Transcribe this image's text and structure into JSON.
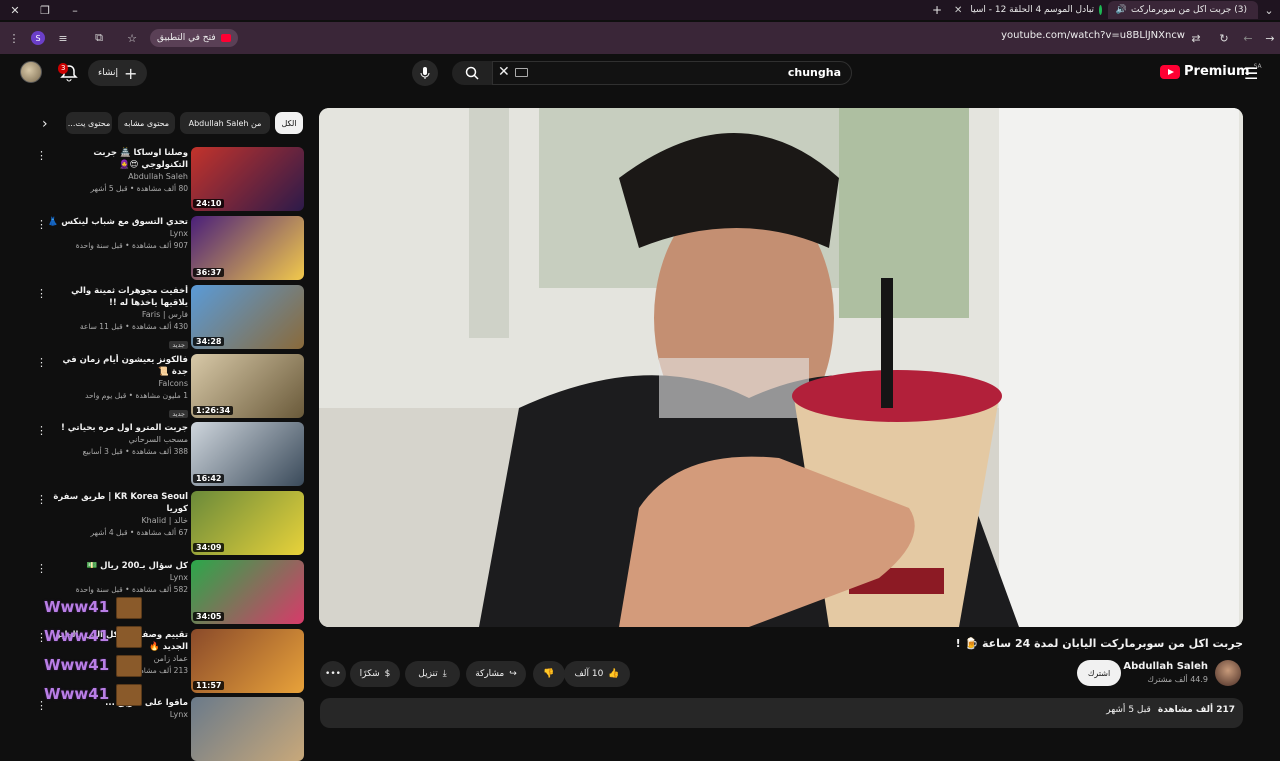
{
  "browser": {
    "tabs": [
      {
        "title": "(3) جربت اكل من سوبرماركت",
        "active": true,
        "fav_color": "#ff0033"
      },
      {
        "title": "تبادل الموسم 4 الحلقة 12 - اسيا",
        "active": false,
        "fav_color": "#1db954"
      }
    ],
    "url": "youtube.com/watch?v=u8BLlJNXncw",
    "open_in_app": "فتح في التطبيق",
    "extension_letter": "S"
  },
  "youtube": {
    "logo_text": "Premium",
    "logo_region": "SA",
    "search_value": "chungha",
    "create_label": "إنشاء",
    "notif_count": "3"
  },
  "video": {
    "title": "جربت اكل من سوبرماركت اليابان لمدة 24 ساعة 🍺 !",
    "channel": "Abdullah Saleh",
    "subscribers": "44.9 ألف مشترك",
    "subscribe_label": "اشترك",
    "likes": "10 آلف",
    "share_label": "مشاركة",
    "download_label": "تنزيل",
    "thanks_label": "شكرًا",
    "views_meta": "217 ألف مشاهدة",
    "date_meta": "قبل 5 أشهر"
  },
  "chips": [
    {
      "label": "الكل",
      "selected": true
    },
    {
      "label": "من Abdullah Saleh",
      "selected": false
    },
    {
      "label": "محتوى مشابه",
      "selected": false
    },
    {
      "label": "محتوى يت...",
      "selected": false
    }
  ],
  "related": [
    {
      "title": "وصلنا اوساكا 🏯 جربت التكنولوجي 😍🧕",
      "channel": "Abdullah Saleh",
      "meta": "80 ألف مشاهدة • قبل 5 أشهر",
      "duration": "24:10",
      "badge": "",
      "c1": "#c3332b",
      "c2": "#2c1a4a"
    },
    {
      "title": "تحدي التسوق مع شباب لينكس 👗",
      "channel": "Lynx",
      "meta": "907 ألف مشاهدة • قبل سنة واحدة",
      "duration": "36:37",
      "badge": "",
      "c1": "#4a1f7a",
      "c2": "#f2c94c"
    },
    {
      "title": "أخفيت مجوهرات ثمينة والي يلاقيها ياخذها له !!",
      "channel": "فارس | Faris",
      "meta": "430 ألف مشاهدة • قبل 11 ساعة",
      "duration": "34:28",
      "badge": "جديد",
      "c1": "#5a9bd8",
      "c2": "#8a6a3a"
    },
    {
      "title": "فالكونز يعيشون أيام زمان في جدة 📜",
      "channel": "Falcons",
      "meta": "1 مليون مشاهدة • قبل يوم واحد",
      "duration": "1:26:34",
      "badge": "جديد",
      "c1": "#d8c9a8",
      "c2": "#6a5a3a"
    },
    {
      "title": "جربت المترو اول مره بحياتي !",
      "channel": "مسحب السرحاني",
      "meta": "388 ألف مشاهدة • قبل 3 أسابيع",
      "duration": "16:42",
      "badge": "",
      "c1": "#cfd6dd",
      "c2": "#3a4a5a"
    },
    {
      "title": "KR Korea Seoul | طريق سفرة كوريا",
      "channel": "خالد | Khalid",
      "meta": "67 ألف مشاهدة • قبل 4 أشهر",
      "duration": "34:09",
      "badge": "",
      "c1": "#6a8a3a",
      "c2": "#e8d23a"
    },
    {
      "title": "كل سؤال بـ200 ريال 💵",
      "channel": "Lynx",
      "meta": "582 ألف مشاهدة • قبل سنة واحدة",
      "duration": "34:05",
      "badge": "",
      "c1": "#2aa84a",
      "c2": "#d83a6a"
    },
    {
      "title": "تقييم وصفات الأكل اللي بالطبق الجديد 🔥",
      "channel": "عماد زامن",
      "meta": "213 ألف مشاهدة",
      "duration": "11:57",
      "badge": "",
      "c1": "#8a4a2a",
      "c2": "#e8a23a"
    },
    {
      "title": "ماقوا على طريق ...",
      "channel": "Lynx",
      "meta": "",
      "duration": "",
      "badge": "",
      "c1": "#6a7a8a",
      "c2": "#c8a87a"
    }
  ],
  "watermark": {
    "text": "Www41"
  }
}
